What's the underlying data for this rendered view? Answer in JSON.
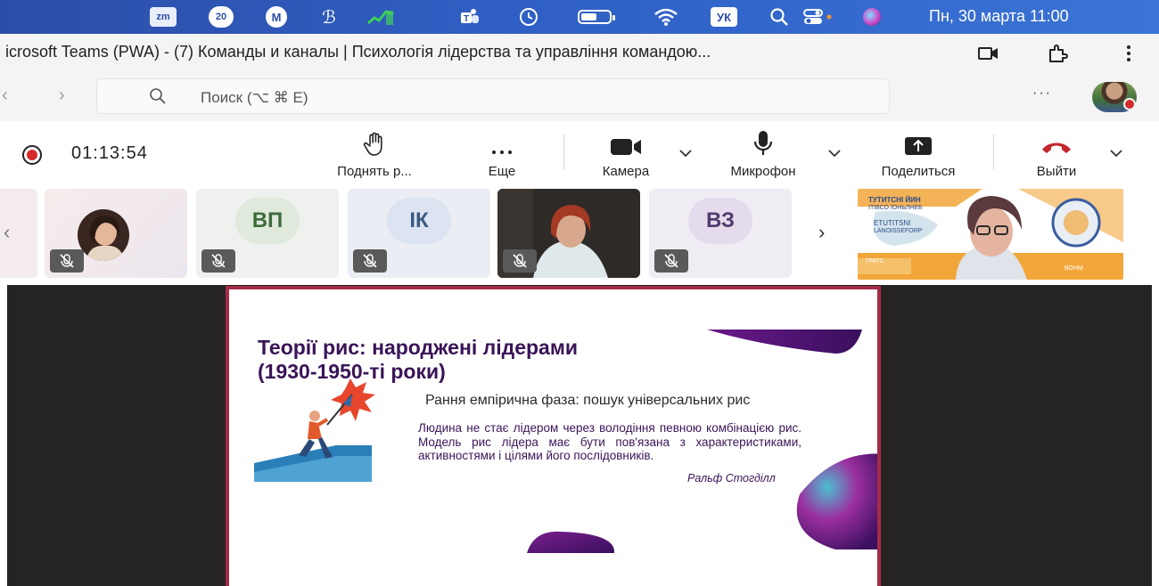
{
  "menubar": {
    "zoom_label": "zm",
    "badge_label": "20",
    "m_label": "M",
    "lang_label": "УК",
    "datetime": "Пн, 30 марта  11:00",
    "battery_level": 0.55
  },
  "browser": {
    "title": "icrosoft Teams (PWA) - (7) Команды и каналы | Психологія лідерства та управління командою..."
  },
  "search": {
    "placeholder": "Поиск (⌥ ⌘ E)",
    "more_label": "···"
  },
  "meeting": {
    "timer": "01:13:54",
    "controls": {
      "raise_hand": "Поднять р...",
      "more": "Еще",
      "camera": "Камера",
      "microphone": "Микрофон",
      "share": "Поделиться",
      "leave": "Выйти"
    }
  },
  "participants": [
    {
      "type": "photo",
      "initials": ""
    },
    {
      "type": "initials",
      "initials": "ВП"
    },
    {
      "type": "initials",
      "initials": "ІК"
    },
    {
      "type": "video",
      "initials": ""
    },
    {
      "type": "initials",
      "initials": "ВЗ"
    }
  ],
  "presenter_banner": {
    "lines": [
      "ТУТИТСНІ ЙИН",
      "ІТІВСО ЇОНЬЛНЕБ",
      "ЕТUTITSNI",
      "LANOISSEFORP",
      "ТРАТС",
      "ВОНМ"
    ]
  },
  "slide": {
    "title_line1": "Теорії рис: народжені лідерами",
    "title_line2": "(1930-1950-ті роки)",
    "subtitle": "Рання емпірична фаза: пошук універсальних рис",
    "body": "Людина не стає лідером через володіння певною комбінацією рис. Модель рис лідера має бути пов'язана з характеристиками, активностями і цілями його послідовників.",
    "author": "Ральф Стогділл"
  },
  "colors": {
    "menubar": "#2f5fc4",
    "record": "#d52a2a",
    "leave": "#c4262e",
    "slide_border": "#a52b48",
    "slide_title": "#3a1457",
    "stage": "#252423"
  }
}
